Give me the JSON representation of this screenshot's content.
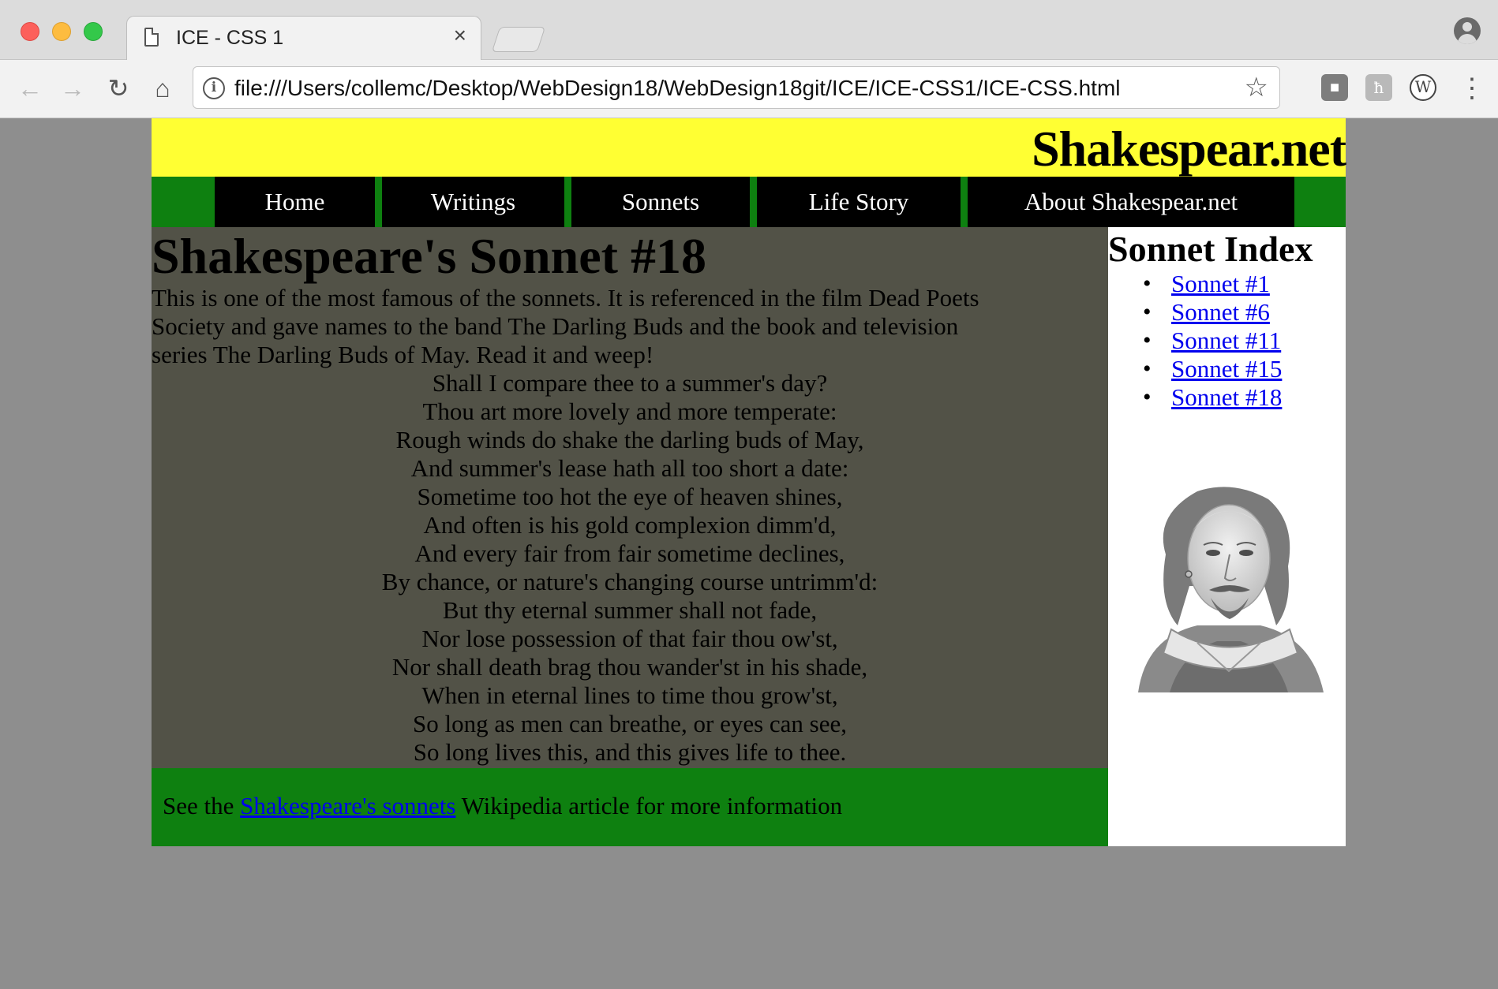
{
  "browser": {
    "tab_title": "ICE - CSS 1",
    "url": "file:///Users/collemc/Desktop/WebDesign18/WebDesign18git/ICE/ICE-CSS1/ICE-CSS.html",
    "close_glyph": "×",
    "ext_2_glyph": "ħ",
    "ext_3_glyph": "W"
  },
  "site": {
    "title": "Shakespear.net",
    "nav": [
      "Home",
      "Writings",
      "Sonnets",
      "Life Story",
      "About Shakespear.net"
    ]
  },
  "main": {
    "heading": "Shakespeare's Sonnet #18",
    "intro": "This is one of the most famous of the sonnets. It is referenced in the film Dead Poets Society and gave names to the band The Darling Buds and the book and television series The Darling Buds of May. Read it and weep!",
    "poem": [
      "Shall I compare thee to a summer's day?",
      "Thou art more lovely and more temperate:",
      "Rough winds do shake the darling buds of May,",
      "And summer's lease hath all too short a date:",
      "Sometime too hot the eye of heaven shines,",
      "And often is his gold complexion dimm'd,",
      "And every fair from fair sometime declines,",
      "By chance, or nature's changing course untrimm'd:",
      "But thy eternal summer shall not fade,",
      "Nor lose possession of that fair thou ow'st,",
      "Nor shall death brag thou wander'st in his shade,",
      "When in eternal lines to time thou grow'st,",
      "So long as men can breathe, or eyes can see,",
      "So long lives this, and this gives life to thee."
    ]
  },
  "footer": {
    "prefix": "See the ",
    "link": "Shakespeare's sonnets",
    "suffix": " Wikipedia article for more information"
  },
  "sidebar": {
    "heading": "Sonnet Index",
    "links": [
      "Sonnet #1",
      "Sonnet #6",
      "Sonnet #11",
      "Sonnet #15",
      "Sonnet #18"
    ]
  },
  "colors": {
    "header_bg": "#ffff33",
    "nav_bg": "#0e8010",
    "nav_item_bg": "#000000",
    "main_bg": "#525247",
    "footer_bg": "#0e8010",
    "sidebar_bg": "#ffffff",
    "link": "#0000ee",
    "page_bg": "#8e8e8e"
  }
}
